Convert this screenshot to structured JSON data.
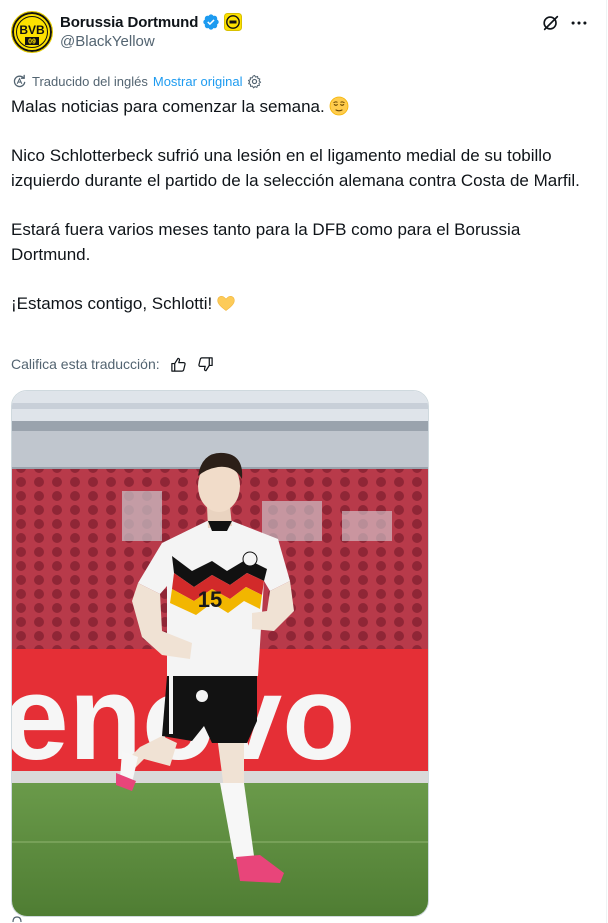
{
  "author": {
    "name": "Borussia Dortmund",
    "handle": "@BlackYellow",
    "avatar_text": "BVB",
    "avatar_number": "09",
    "verified": true
  },
  "translation_bar": {
    "label": "Traducido del inglés",
    "show_original": "Mostrar original"
  },
  "tweet": {
    "line1": "Malas noticias para comenzar la semana.",
    "line2": "Nico Schlotterbeck sufrió una lesión en el ligamento medial de su tobillo izquierdo durante el partido de la selección alemana contra Costa de Marfil.",
    "line3": "Estará fuera varios meses tanto para la DFB como para el Borussia Dortmund.",
    "line4": "¡Estamos contigo, Schlotti!"
  },
  "rating": {
    "label": "Califica esta traducción:"
  },
  "photo": {
    "jersey_number": "15",
    "ad_board_text": "enovo"
  },
  "colors": {
    "link": "#1d9bf0",
    "muted": "#536471",
    "verified": "#1d9bf0",
    "bvb_yellow": "#fde100"
  },
  "icons": {
    "verified": "verified-badge-icon",
    "grok": "grok-icon",
    "more": "more-dots-icon",
    "translate": "translate-icon",
    "settings": "gear-icon",
    "thumb_up": "thumb-up-icon",
    "thumb_down": "thumb-down-icon",
    "emoji_relieved": "relieved-face-emoji",
    "emoji_heart": "yellow-heart-emoji"
  }
}
